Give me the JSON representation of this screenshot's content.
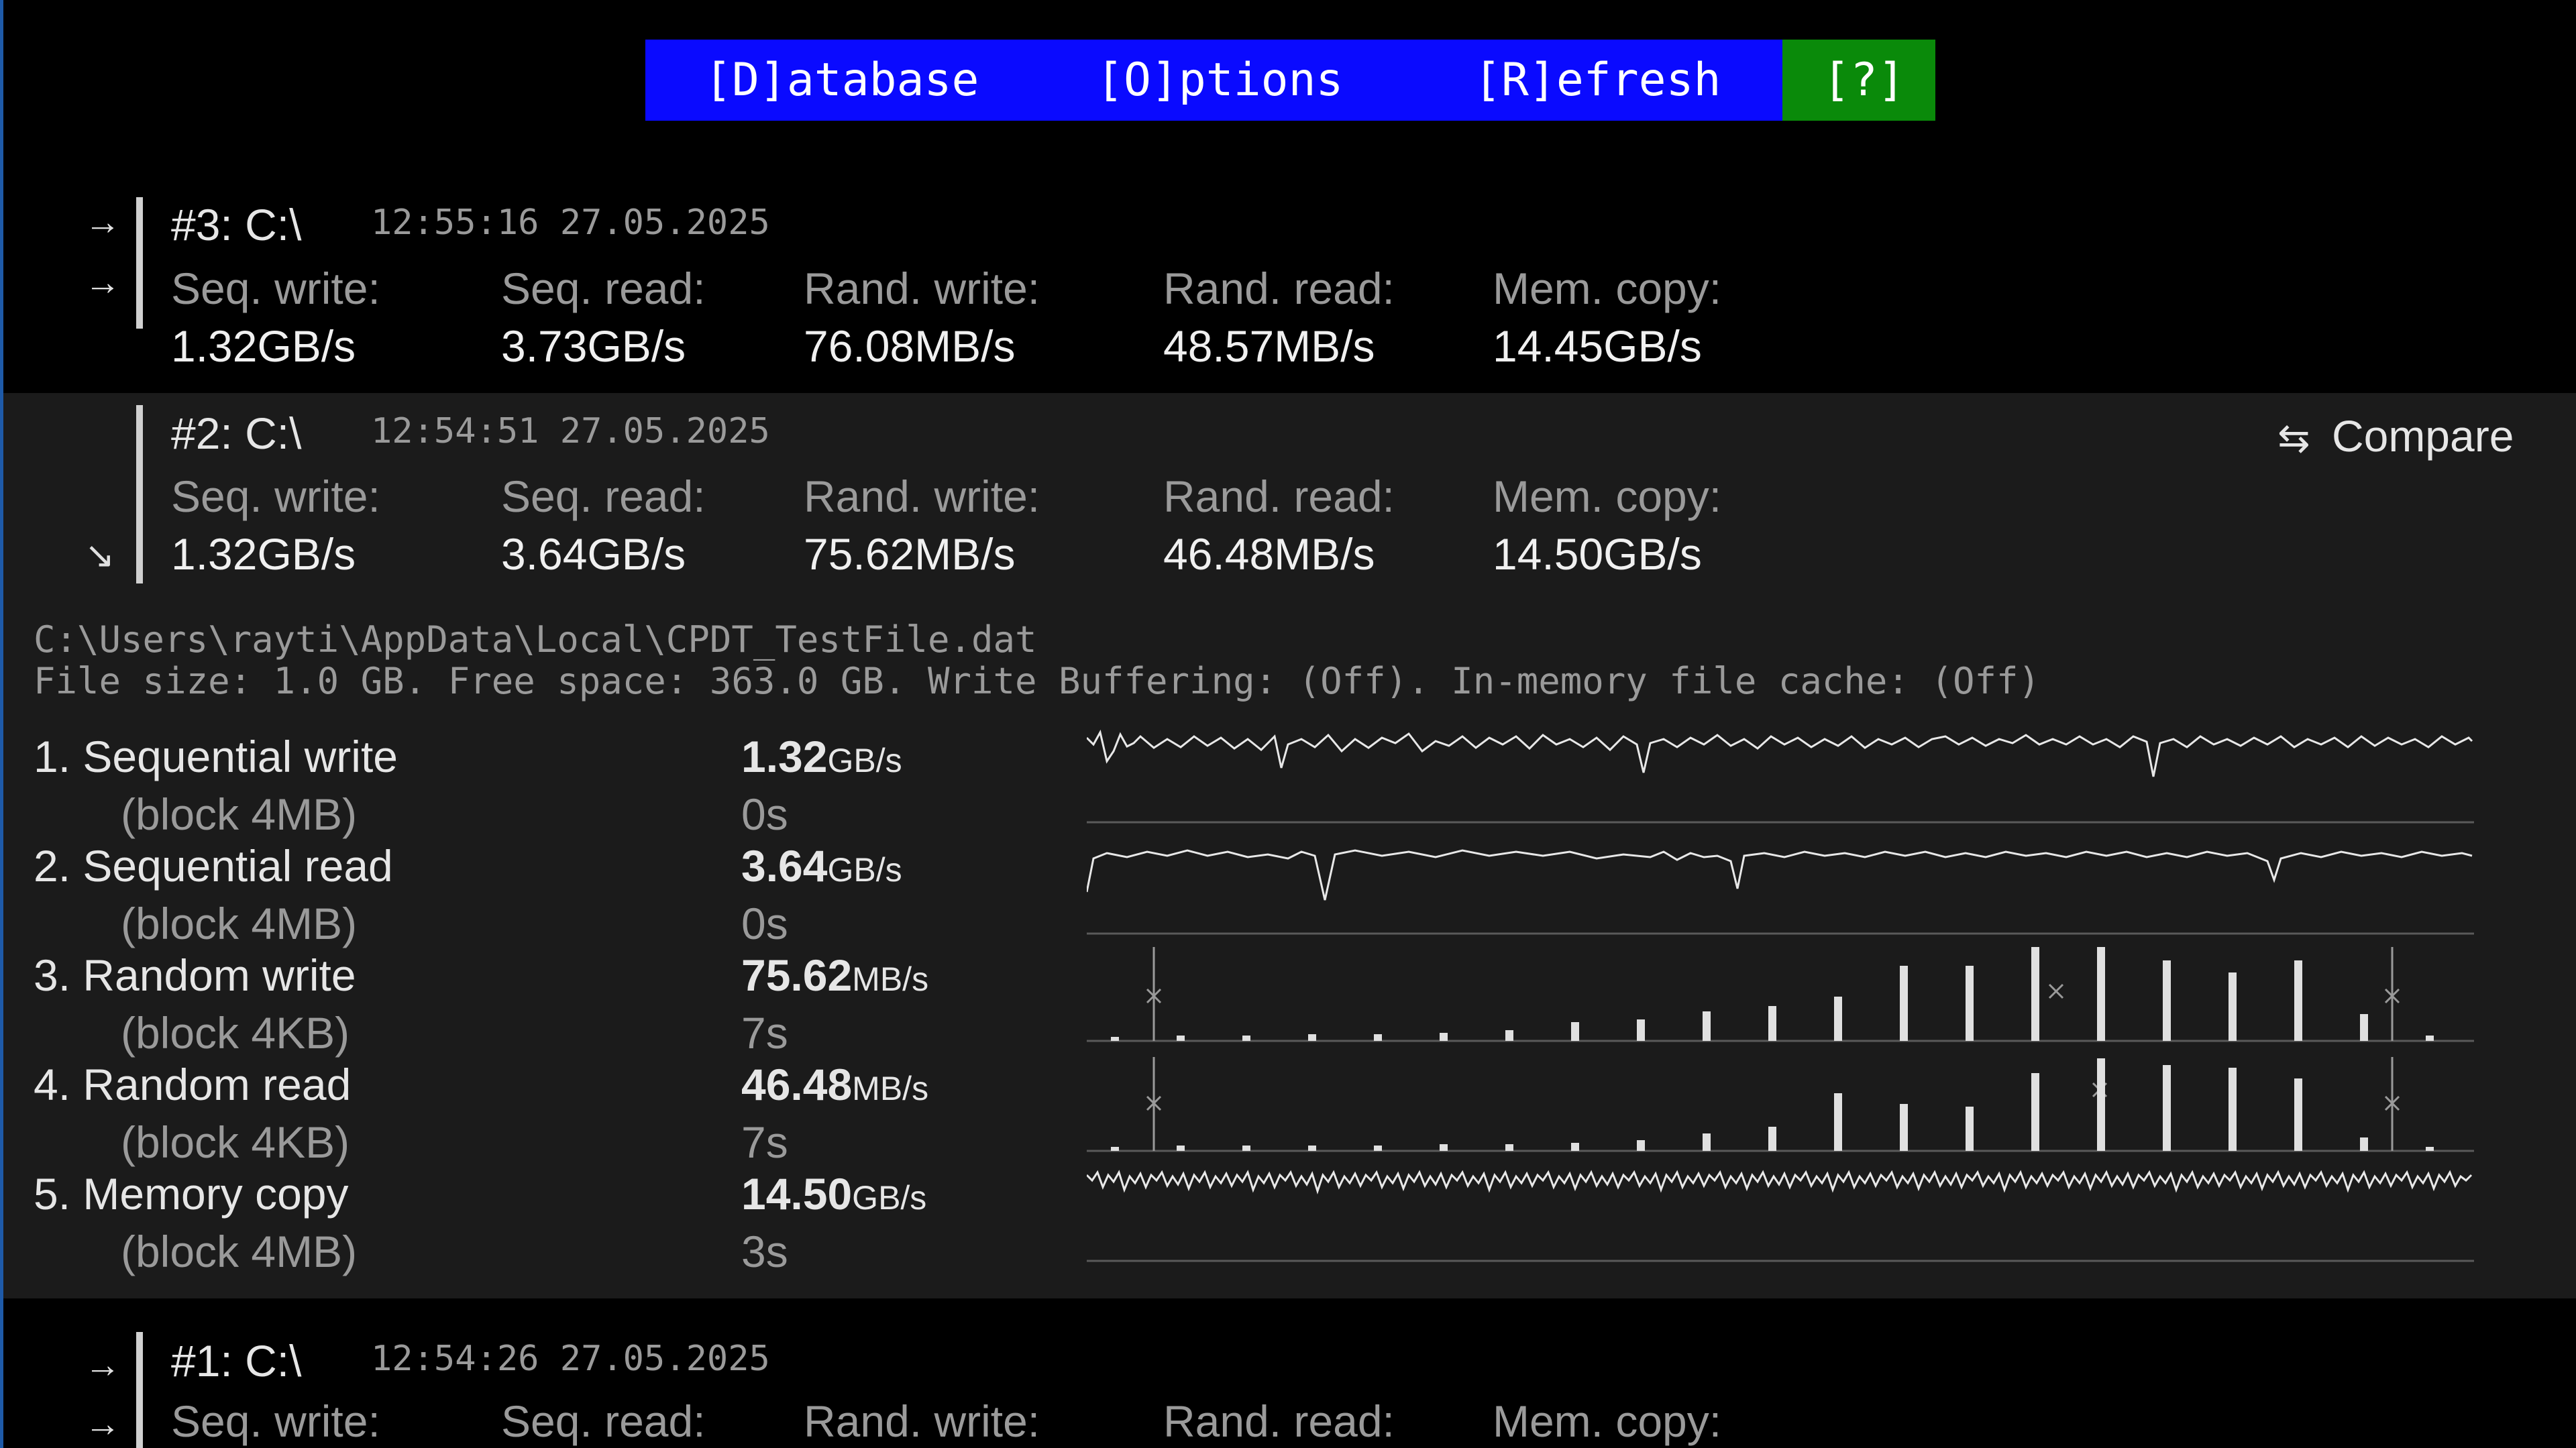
{
  "menu": {
    "database": "[D]atabase",
    "options": "[O]ptions",
    "refresh": "[R]efresh",
    "help": "[?]"
  },
  "icons": {
    "row_arrow": "→",
    "row_arrow_diag": "↘",
    "compare_icon": "⇆"
  },
  "headers": [
    "Seq. write:",
    "Seq. read:",
    "Rand. write:",
    "Rand. read:",
    "Mem. copy:"
  ],
  "results": [
    {
      "title": "#3: C:\\",
      "time": "12:55:16 27.05.2025",
      "values": [
        "1.32GB/s",
        "3.73GB/s",
        "76.08MB/s",
        "48.57MB/s",
        "14.45GB/s"
      ]
    },
    {
      "title": "#2: C:\\",
      "time": "12:54:51 27.05.2025",
      "values": [
        "1.32GB/s",
        "3.64GB/s",
        "75.62MB/s",
        "46.48MB/s",
        "14.50GB/s"
      ]
    },
    {
      "title": "#1: C:\\",
      "time": "12:54:26 27.05.2025"
    }
  ],
  "compare": {
    "label": "Compare"
  },
  "details": {
    "file_path": "C:\\Users\\rayti\\AppData\\Local\\CPDT_TestFile.dat",
    "file_info": "File size: 1.0 GB. Free space: 363.0 GB. Write Buffering: (Off). In-memory file cache: (Off)",
    "tests": [
      {
        "name": "1. Sequential write",
        "block": "(block 4MB)",
        "value": "1.32",
        "unit": "GB/s",
        "time": "0s"
      },
      {
        "name": "2. Sequential read",
        "block": "(block 4MB)",
        "value": "3.64",
        "unit": "GB/s",
        "time": "0s"
      },
      {
        "name": "3. Random write",
        "block": "(block 4KB)",
        "value": "75.62",
        "unit": "MB/s",
        "time": "7s"
      },
      {
        "name": "4. Random read",
        "block": "(block 4KB)",
        "value": "46.48",
        "unit": "MB/s",
        "time": "7s"
      },
      {
        "name": "5. Memory copy",
        "block": "(block 4MB)",
        "value": "14.50",
        "unit": "GB/s",
        "time": "3s"
      }
    ]
  },
  "colors": {
    "menu_bg": "#0a0aff",
    "help_bg": "#0a8a0a",
    "selected_bg": "#1b1b1b"
  }
}
